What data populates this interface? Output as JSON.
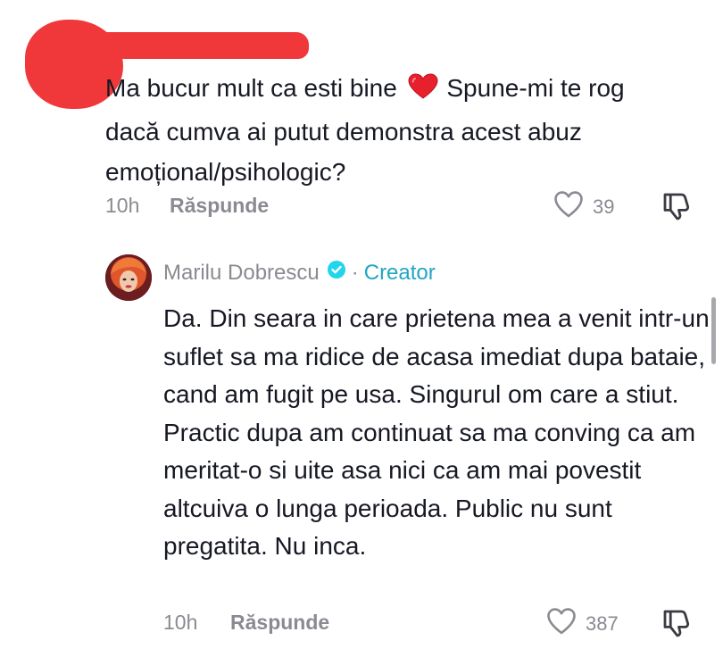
{
  "colors": {
    "text": "#161823",
    "meta": "#8a8b91",
    "creator_accent": "#21a5c4",
    "verified_badge": "#20d5ec",
    "heart_emoji": "#e8202e",
    "redaction": "#f0383a"
  },
  "comment": {
    "redacted_username": true,
    "text_before_emoji": "Ma bucur mult ca esti bine",
    "emoji": "heart-emoji",
    "text_after_emoji": "Spune-mi te rog dacă cumva ai putut demonstra acest abuz emoțional/psihologic?",
    "time": "10h",
    "reply_label": "Răspunde",
    "like_count": "39",
    "like_icon": "heart-outline-icon",
    "dislike_icon": "thumbs-down-icon"
  },
  "reply": {
    "author": "Marilu Dobrescu",
    "verified_icon": "verified-badge-icon",
    "separator": "·",
    "role": "Creator",
    "text": "Da. Din seara in care prietena mea a venit intr-un suflet sa ma ridice de acasa imediat dupa bataie, cand am fugit pe usa. Singurul om care a stiut. Practic dupa am continuat sa ma conving ca am meritat-o si uite asa nici ca am mai povestit altcuiva o lunga perioada. Public nu sunt pregatita. Nu inca.",
    "time": "10h",
    "reply_label": "Răspunde",
    "like_count": "387",
    "like_icon": "heart-outline-icon",
    "dislike_icon": "thumbs-down-icon"
  }
}
